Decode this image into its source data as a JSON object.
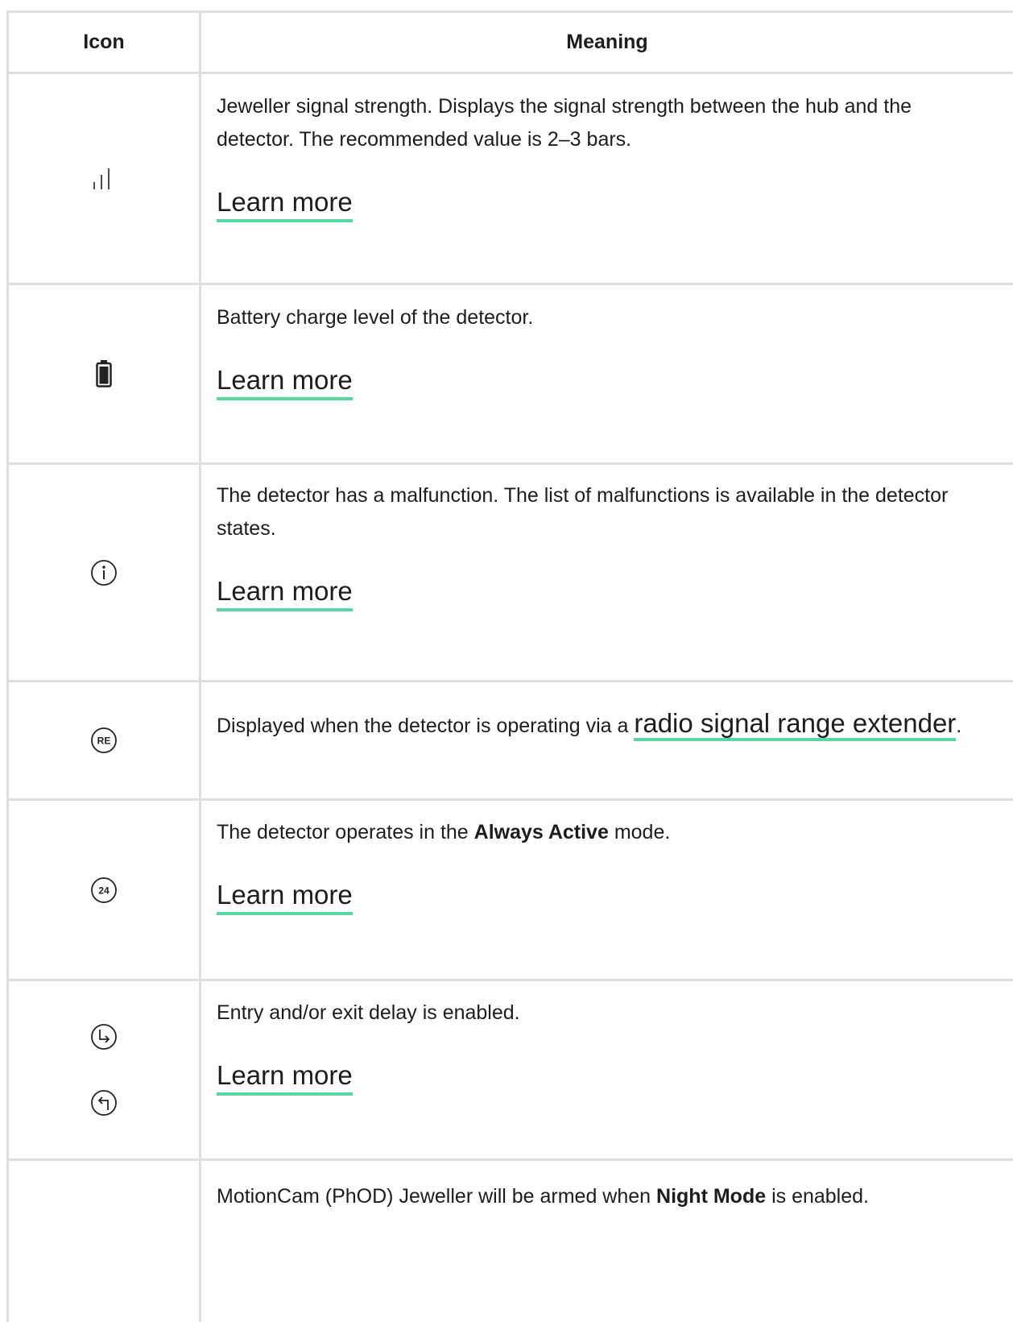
{
  "table": {
    "header": {
      "icon": "Icon",
      "meaning": "Meaning"
    },
    "rows": [
      {
        "icon": "signal-strength-icon",
        "text": "Jeweller signal strength. Displays the signal strength between the hub and the detector. The recommended value is 2–3 bars.",
        "link": "Learn more"
      },
      {
        "icon": "battery-icon",
        "text": "Battery charge level of the detector.",
        "link": "Learn more"
      },
      {
        "icon": "info-icon",
        "text": "The detector has a malfunction. The list of malfunctions is available in the detector states.",
        "link": "Learn more"
      },
      {
        "icon": "range-extender-icon",
        "text_before": "Displayed when the detector is operating via a ",
        "inline_link": "radio signal range extender",
        "text_after": "."
      },
      {
        "icon": "always-active-icon",
        "text_before": "The detector operates in the ",
        "bold": "Always Active",
        "text_after": " mode.",
        "link": "Learn more"
      },
      {
        "icons": [
          "entry-delay-icon",
          "exit-delay-icon"
        ],
        "text": "Entry and/or exit delay is enabled.",
        "link": "Learn more"
      },
      {
        "text_before": "MotionCam (PhOD) Jeweller will be armed when ",
        "bold": "Night Mode",
        "text_after": " is enabled."
      }
    ]
  },
  "icon_labels": {
    "range_extender": "RE",
    "always_active": "24"
  },
  "colors": {
    "link_underline": "#5ad6a6",
    "border": "#dedede",
    "text": "#1d1d1d"
  }
}
